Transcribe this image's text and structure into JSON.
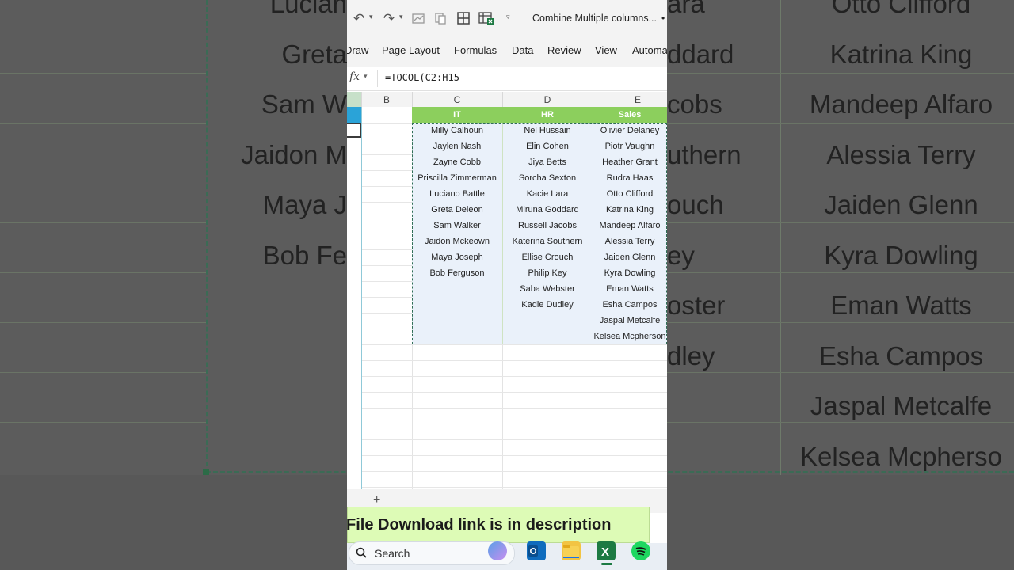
{
  "background": {
    "left_column": [
      "Lucian",
      "Greta",
      "Sam W",
      "Jaidon M",
      "Maya J",
      "Bob Fe"
    ],
    "middle_column": [
      "ara",
      "ddard",
      "cobs",
      "uthern",
      "ouch",
      "ey",
      "oster",
      "dley"
    ],
    "right_column": [
      "Otto Clifford",
      "Katrina King",
      "Mandeep Alfaro",
      "Alessia Terry",
      "Jaiden Glenn",
      "Kyra Dowling",
      "Eman Watts",
      "Esha Campos",
      "Jaspal Metcalfe",
      "Kelsea Mcpherso"
    ]
  },
  "toolbar": {
    "title": "Combine Multiple columns...",
    "title_dot": "•"
  },
  "ribbon": {
    "tabs": [
      "Draw",
      "Page Layout",
      "Formulas",
      "Data",
      "Review",
      "View",
      "Automa"
    ]
  },
  "formula_bar": {
    "fx_label": "fx",
    "formula": "=TOCOL(C2:H15"
  },
  "columns": {
    "B": "B",
    "C": "C",
    "D": "D",
    "E": "E"
  },
  "table": {
    "headers": [
      "IT",
      "HR",
      "Sales"
    ],
    "rows": [
      [
        "Milly Calhoun",
        "Nel Hussain",
        "Olivier Delaney"
      ],
      [
        "Jaylen Nash",
        "Elin Cohen",
        "Piotr Vaughn"
      ],
      [
        "Zayne Cobb",
        "Jiya Betts",
        "Heather Grant"
      ],
      [
        "Priscilla Zimmerman",
        "Sorcha Sexton",
        "Rudra Haas"
      ],
      [
        "Luciano Battle",
        "Kacie Lara",
        "Otto Clifford"
      ],
      [
        "Greta Deleon",
        "Miruna Goddard",
        "Katrina King"
      ],
      [
        "Sam Walker",
        "Russell Jacobs",
        "Mandeep Alfaro"
      ],
      [
        "Jaidon Mckeown",
        "Katerina Southern",
        "Alessia Terry"
      ],
      [
        "Maya Joseph",
        "Ellise Crouch",
        "Jaiden Glenn"
      ],
      [
        "Bob Ferguson",
        "Philip Key",
        "Kyra Dowling"
      ],
      [
        "",
        "Saba Webster",
        "Eman Watts"
      ],
      [
        "",
        "Kadie Dudley",
        "Esha Campos"
      ],
      [
        "",
        "",
        "Jaspal Metcalfe"
      ],
      [
        "",
        "",
        "Kelsea Mcpherson"
      ]
    ]
  },
  "sheetbar": {
    "add_label": "+"
  },
  "banner": {
    "text": "File Download link is in description"
  },
  "taskbar": {
    "search_label": "Search"
  },
  "colors": {
    "header_green": "#8ccf5d",
    "row_blue": "#eaf1fa",
    "banner_green": "#ddfbb6",
    "excel_green": "#1d7a43"
  }
}
